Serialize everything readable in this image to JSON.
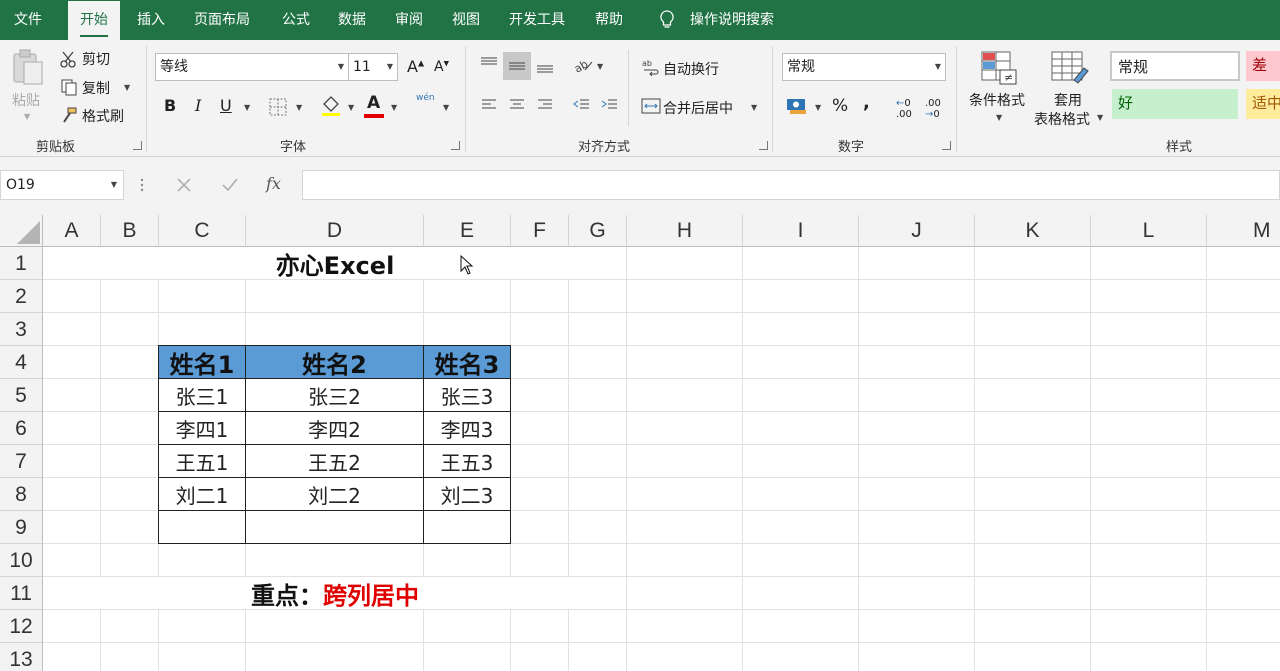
{
  "tabs": [
    "文件",
    "开始",
    "插入",
    "页面布局",
    "公式",
    "数据",
    "审阅",
    "视图",
    "开发工具",
    "帮助"
  ],
  "tell_me": "操作说明搜索",
  "clipboard": {
    "paste": "粘贴",
    "cut": "剪切",
    "copy": "复制",
    "format_painter": "格式刷",
    "label": "剪贴板"
  },
  "font": {
    "name": "等线",
    "size": "11",
    "bold": "B",
    "italic": "I",
    "underline": "U",
    "grow": "A",
    "shrink": "A",
    "color_letter": "A",
    "phonetic": "wén",
    "label": "字体"
  },
  "alignment": {
    "wrap": "自动换行",
    "merge": "合并后居中",
    "label": "对齐方式"
  },
  "number": {
    "format": "常规",
    "percent": "%",
    "comma": ",",
    "increase_decimal": ".00",
    "decrease_decimal": ".00",
    "label": "数字"
  },
  "styles": {
    "conditional": "条件格式",
    "table_line1": "套用",
    "table_line2": "表格格式",
    "normal": "常规",
    "bad": "差",
    "good": "好",
    "neutral": "适中",
    "label": "样式"
  },
  "name_box": "O19",
  "fx": "fx",
  "columns": [
    "A",
    "B",
    "C",
    "D",
    "E",
    "F",
    "G",
    "H",
    "I",
    "J",
    "K",
    "L",
    "M"
  ],
  "rows": [
    "1",
    "2",
    "3",
    "4",
    "5",
    "6",
    "7",
    "8",
    "9",
    "10",
    "11",
    "12",
    "13"
  ],
  "sheet": {
    "title": "亦心Excel",
    "headers": [
      "姓名1",
      "姓名2",
      "姓名3"
    ],
    "data": [
      [
        "张三1",
        "张三2",
        "张三3"
      ],
      [
        "李四1",
        "李四2",
        "李四3"
      ],
      [
        "王五1",
        "王五2",
        "王五3"
      ],
      [
        "刘二1",
        "刘二2",
        "刘二3"
      ],
      [
        "",
        "",
        ""
      ]
    ],
    "note_label": "重点：",
    "note_value": "跨列居中"
  },
  "colors": {
    "excel_green": "#217346",
    "header_fill": "#5b9bd5",
    "note_red": "#e00000",
    "good_fill": "#c6efce",
    "bad_fill": "#ffc7ce",
    "neutral_fill": "#ffeb9c"
  }
}
